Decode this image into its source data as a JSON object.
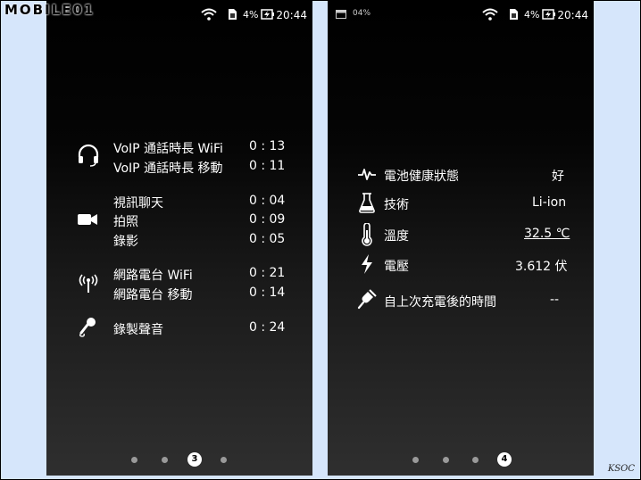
{
  "watermark": {
    "logo": "MOBILE01",
    "corner": "KSOC"
  },
  "left_screen": {
    "status": {
      "battery_pct": "4%",
      "time": "20:44"
    },
    "groups": [
      {
        "icon": "headset-icon",
        "rows": [
          {
            "label": "VoIP 通話時長 WiFi",
            "value": "0 : 13"
          },
          {
            "label": "VoIP 通話時長 移動",
            "value": "0 : 11"
          }
        ]
      },
      {
        "icon": "video-camera-icon",
        "rows": [
          {
            "label": "視訊聊天",
            "value": "0 : 04"
          },
          {
            "label": "拍照",
            "value": "0 : 09"
          },
          {
            "label": "錄影",
            "value": "0 : 05"
          }
        ]
      },
      {
        "icon": "radio-antenna-icon",
        "rows": [
          {
            "label": "網路電台 WiFi",
            "value": "0 : 21"
          },
          {
            "label": "網路電台 移動",
            "value": "0 : 14"
          }
        ]
      },
      {
        "icon": "microphone-icon",
        "rows": [
          {
            "label": "錄製聲音",
            "value": "0 : 24"
          }
        ]
      }
    ],
    "page_indicator": {
      "active": "3"
    }
  },
  "right_screen": {
    "status": {
      "notif": "04%",
      "battery_pct": "4%",
      "time": "20:44"
    },
    "items": [
      {
        "icon": "pulse-icon",
        "label": "電池健康狀態",
        "value": "好"
      },
      {
        "icon": "flask-icon",
        "label": "技術",
        "value": "Li-ion"
      },
      {
        "icon": "thermometer-icon",
        "label": "溫度",
        "value": "32.5 ℃"
      },
      {
        "icon": "lightning-icon",
        "label": "電壓",
        "value": "3.612 伏"
      },
      {
        "icon": "plug-icon",
        "label": "自上次充電後的時間",
        "value": "--"
      }
    ],
    "page_indicator": {
      "active": "4"
    }
  },
  "colors": {
    "background": "#d6e6fb",
    "text": "#ffffff",
    "dot_inactive": "#9a9a9a"
  }
}
